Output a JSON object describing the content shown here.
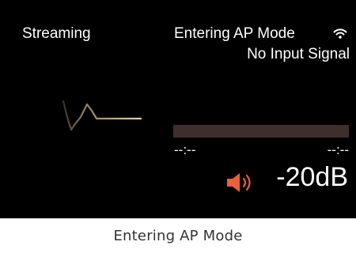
{
  "display": {
    "source": "Streaming",
    "status": "Entering AP Mode",
    "signal": "No Input Signal",
    "time_elapsed": "--:--",
    "time_remaining": "--:--",
    "volume": "-20dB",
    "progress": 0
  },
  "caption": "Entering AP Mode",
  "icons": {
    "wifi": "wifi-icon",
    "volume": "volume-icon",
    "waveform": "waveform-icon"
  },
  "colors": {
    "screen_bg": "#000000",
    "text": "#ffffff",
    "accent": "#e8603c",
    "progress_track": "#3e2f2c",
    "waveform": "#c9b37a"
  }
}
